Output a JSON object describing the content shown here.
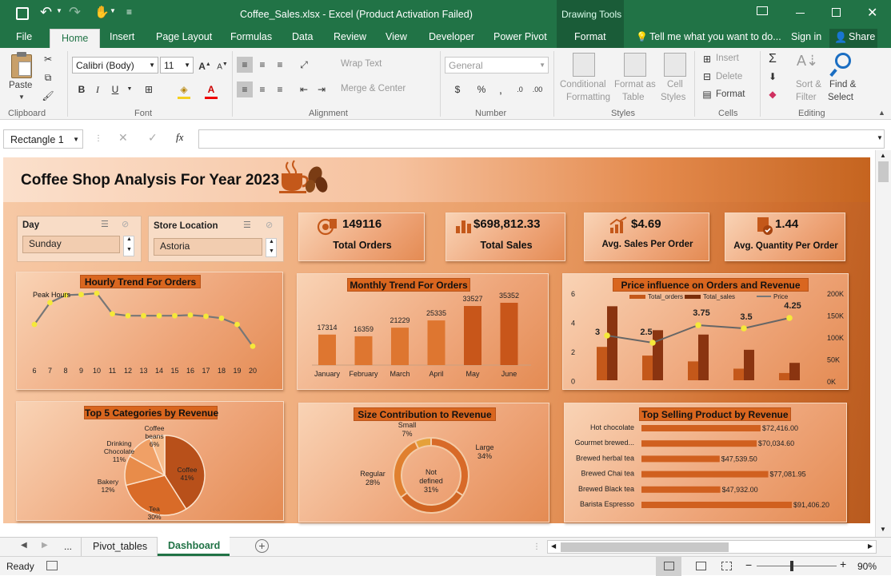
{
  "window": {
    "title": "Coffee_Sales.xlsx - Excel (Product Activation Failed)",
    "context_tab": "Drawing Tools"
  },
  "menu": {
    "tabs": [
      "File",
      "Home",
      "Insert",
      "Page Layout",
      "Formulas",
      "Data",
      "Review",
      "View",
      "Developer",
      "Power Pivot",
      "Format"
    ],
    "active": "Home",
    "tell_me": "Tell me what you want to do...",
    "sign_in": "Sign in",
    "share": "Share"
  },
  "ribbon": {
    "clipboard": {
      "paste": "Paste",
      "group": "Clipboard"
    },
    "font": {
      "name": "Calibri (Body)",
      "size": "11",
      "group": "Font"
    },
    "alignment": {
      "wrap": "Wrap Text",
      "merge": "Merge & Center",
      "group": "Alignment"
    },
    "number": {
      "format": "General",
      "group": "Number"
    },
    "styles": {
      "cond1": "Conditional",
      "cond2": "Formatting",
      "fmt1": "Format as",
      "fmt2": "Table",
      "cell1": "Cell",
      "cell2": "Styles",
      "group": "Styles"
    },
    "cells": {
      "insert": "Insert",
      "delete": "Delete",
      "format": "Format",
      "group": "Cells"
    },
    "editing": {
      "sort1": "Sort &",
      "sort2": "Filter",
      "find1": "Find &",
      "find2": "Select",
      "group": "Editing"
    }
  },
  "formula_bar": {
    "name_box": "Rectangle 1",
    "fx": "fx",
    "content": ""
  },
  "dashboard": {
    "title": "Coffee Shop Analysis For Year 2023",
    "slicers": [
      {
        "label": "Day",
        "value": "Sunday"
      },
      {
        "label": "Store Location",
        "value": "Astoria"
      }
    ],
    "kpis": [
      {
        "value": "149116",
        "label": "Total Orders",
        "icon": "target-icon"
      },
      {
        "value": "$698,812.33",
        "label": "Total Sales",
        "icon": "bar-chart-icon"
      },
      {
        "value": "$4.69",
        "label": "Avg. Sales Per Order",
        "icon": "growth-chart-icon"
      },
      {
        "value": "1.44",
        "label": "Avg. Quantity Per Order",
        "icon": "document-check-icon"
      }
    ],
    "hourly": {
      "title": "Hourly Trend For Orders",
      "annotation": "Peak Hours"
    },
    "monthly": {
      "title": "Monthly Trend For Orders"
    },
    "price": {
      "title": "Price influence on Orders and Revenue"
    },
    "categories": {
      "title": "Top 5 Categories by Revenue"
    },
    "size": {
      "title": "Size Contribution to Revenue"
    },
    "products": {
      "title": "Top Selling Product by Revenue"
    }
  },
  "chart_data": [
    {
      "type": "line",
      "title": "Hourly Trend For Orders",
      "categories": [
        "6",
        "7",
        "8",
        "9",
        "10",
        "11",
        "12",
        "13",
        "14",
        "15",
        "16",
        "17",
        "18",
        "19",
        "20"
      ],
      "values": [
        5.5,
        9.0,
        10.2,
        10.3,
        10.5,
        7.2,
        6.9,
        6.9,
        6.9,
        6.9,
        7.0,
        6.8,
        6.5,
        5.5,
        2.0
      ],
      "annotations": [
        "Peak Hours"
      ],
      "y_axis_visible": false
    },
    {
      "type": "bar",
      "title": "Monthly Trend For Orders",
      "categories": [
        "January",
        "February",
        "March",
        "April",
        "May",
        "June"
      ],
      "values": [
        17314,
        16359,
        21229,
        25335,
        33527,
        35352
      ],
      "data_labels": true
    },
    {
      "type": "bar",
      "title": "Price influence on Orders and Revenue",
      "categories": [
        "3",
        "2.5",
        "3.75",
        "3.5",
        "4.25"
      ],
      "series": [
        {
          "name": "Total_orders",
          "axis": "left",
          "values": [
            2.3,
            1.7,
            1.3,
            0.8,
            0.5
          ]
        },
        {
          "name": "Total_sales",
          "axis": "right",
          "values": [
            170000,
            115000,
            105000,
            70000,
            40000
          ]
        },
        {
          "name": "Price",
          "type": "line",
          "axis": "left",
          "values": [
            3,
            2.5,
            3.75,
            3.5,
            4.25
          ]
        }
      ],
      "left_ticks": [
        "6",
        "4",
        "2",
        "0"
      ],
      "right_ticks": [
        "200K",
        "150K",
        "100K",
        "50K",
        "0K"
      ],
      "ylim_left": [
        0,
        6
      ],
      "ylim_right": [
        0,
        200000
      ],
      "legend": "top"
    },
    {
      "type": "pie",
      "title": "Top 5 Categories by Revenue",
      "slices": [
        {
          "name": "Coffee",
          "pct": 41
        },
        {
          "name": "Tea",
          "pct": 30
        },
        {
          "name": "Bakery",
          "pct": 12
        },
        {
          "name": "Drinking Chocolate",
          "pct": 11
        },
        {
          "name": "Coffee beans",
          "pct": 6
        }
      ]
    },
    {
      "type": "pie",
      "variant": "doughnut",
      "title": "Size Contribution to Revenue",
      "slices": [
        {
          "name": "Large",
          "pct": 34
        },
        {
          "name": "Not defined",
          "pct": 31
        },
        {
          "name": "Regular",
          "pct": 28
        },
        {
          "name": "Small",
          "pct": 7
        }
      ]
    },
    {
      "type": "bar",
      "orientation": "horizontal",
      "title": "Top Selling Product by Revenue",
      "categories": [
        "Hot chocolate",
        "Gourmet brewed...",
        "Brewed herbal tea",
        "Brewed Chai tea",
        "Brewed Black tea",
        "Barista Espresso"
      ],
      "values": [
        72416.0,
        70034.6,
        47539.5,
        77081.95,
        47932.0,
        91406.2
      ],
      "labels": [
        "$72,416.00",
        "$70,034.60",
        "$47,539.50",
        "$77,081.95",
        "$47,932.00",
        "$91,406.20"
      ]
    }
  ],
  "sheet_tabs": {
    "tabs": [
      "Pivot_tables",
      "Dashboard"
    ],
    "active": "Dashboard",
    "more": "..."
  },
  "status": {
    "ready": "Ready",
    "zoom": "90%"
  },
  "colors": {
    "excel_green": "#217346",
    "dark_orange": "#c45a14",
    "mid_orange": "#e07a35",
    "title_bar": "#d9661f"
  }
}
